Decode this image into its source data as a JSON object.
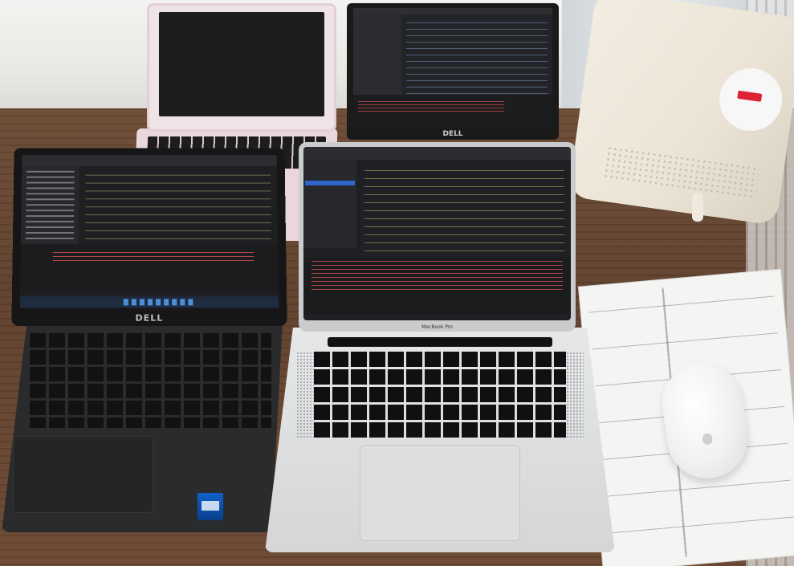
{
  "scene": {
    "description": "",
    "objects": [
      {
        "name": "pink laptop",
        "label": ""
      },
      {
        "name": "back dell laptop",
        "label": "DELL"
      },
      {
        "name": "router",
        "label": ""
      },
      {
        "name": "front dell laptop",
        "label": "DELL"
      },
      {
        "name": "macbook pro",
        "label": "MacBook Pro"
      },
      {
        "name": "paper sketches",
        "label": ""
      },
      {
        "name": "apple mouse",
        "label": ""
      }
    ]
  },
  "labels": {
    "dell_front": "DELL",
    "dell_back": "DELL",
    "macbook": "MacBook Pro"
  },
  "colors": {
    "table": "#6b4a34",
    "mac_silver": "#d4d6d7",
    "dell_black": "#2a2b2d",
    "pink_laptop": "#ead7dc",
    "router": "#ebe4d6",
    "ide_dark": "#1e1f22",
    "error_red": "#d75050",
    "intel_blue": "#1060c8"
  }
}
